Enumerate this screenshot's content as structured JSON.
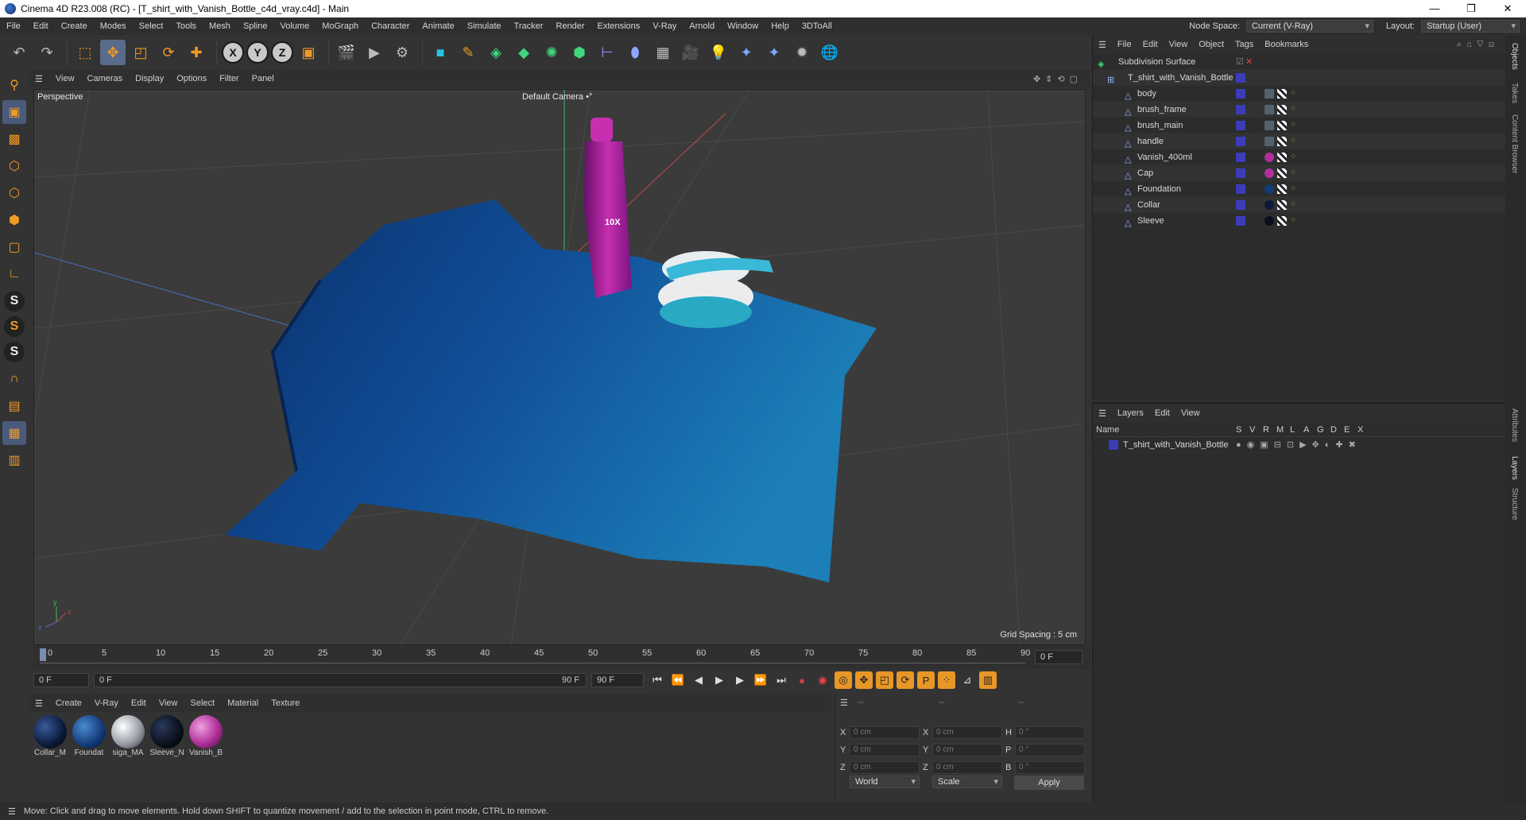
{
  "window": {
    "title": "Cinema 4D R23.008 (RC) - [T_shirt_with_Vanish_Bottle_c4d_vray.c4d] - Main",
    "minimize": "—",
    "maximize": "❐",
    "close": "✕"
  },
  "menubar": {
    "items": [
      "File",
      "Edit",
      "Create",
      "Modes",
      "Select",
      "Tools",
      "Mesh",
      "Spline",
      "Volume",
      "MoGraph",
      "Character",
      "Animate",
      "Simulate",
      "Tracker",
      "Render",
      "Extensions",
      "V-Ray",
      "Arnold",
      "Window",
      "Help",
      "3DToAll"
    ],
    "node_space_label": "Node Space:",
    "node_space_value": "Current (V-Ray)",
    "layout_label": "Layout:",
    "layout_value": "Startup (User)"
  },
  "viewport": {
    "menu": [
      "View",
      "Cameras",
      "Display",
      "Options",
      "Filter",
      "Panel"
    ],
    "label": "Perspective",
    "camera": "Default Camera",
    "camera_suffix": "•°",
    "grid_spacing": "Grid Spacing : 5 cm",
    "axis_x": "x",
    "axis_y": "y",
    "axis_z": "z"
  },
  "timeline": {
    "ticks": [
      "0",
      "5",
      "10",
      "15",
      "20",
      "25",
      "30",
      "35",
      "40",
      "45",
      "50",
      "55",
      "60",
      "65",
      "70",
      "75",
      "80",
      "85",
      "90"
    ],
    "current_frame": "0 F",
    "right_frame": "0 F",
    "start_field": "0 F",
    "range_start": "0 F",
    "range_end": "90 F",
    "end_field": "90 F"
  },
  "materials": {
    "menu": [
      "Create",
      "V-Ray",
      "Edit",
      "View",
      "Select",
      "Material",
      "Texture"
    ],
    "items": [
      {
        "name": "Collar_M",
        "color": "#0b1a3a"
      },
      {
        "name": "Foundat",
        "color": "#123b78"
      },
      {
        "name": "siga_MA",
        "color": "#9aa0a8"
      },
      {
        "name": "Sleeve_N",
        "color": "#0a0f1c"
      },
      {
        "name": "Vanish_B",
        "color": "#b0309a"
      }
    ]
  },
  "coords": {
    "headers": [
      "--",
      "--",
      "--"
    ],
    "rows": [
      {
        "a": "X",
        "av": "0 cm",
        "b": "X",
        "bv": "0 cm",
        "c": "H",
        "cv": "0 °"
      },
      {
        "a": "Y",
        "av": "0 cm",
        "b": "Y",
        "bv": "0 cm",
        "c": "P",
        "cv": "0 °"
      },
      {
        "a": "Z",
        "av": "0 cm",
        "b": "Z",
        "bv": "0 cm",
        "c": "B",
        "cv": "0 °"
      }
    ],
    "world": "World",
    "scale": "Scale",
    "apply": "Apply"
  },
  "objects": {
    "menu": [
      "File",
      "Edit",
      "View",
      "Object",
      "Tags",
      "Bookmarks"
    ],
    "root": "Subdivision Surface",
    "group": "T_shirt_with_Vanish_Bottle",
    "items": [
      {
        "name": "body",
        "mat": "#556070"
      },
      {
        "name": "brush_frame",
        "mat": "#556070"
      },
      {
        "name": "brush_main",
        "mat": "#556070"
      },
      {
        "name": "handle",
        "mat": "#556070"
      },
      {
        "name": "Vanish_400ml",
        "mat": "#b0309a"
      },
      {
        "name": "Cap",
        "mat": "#b0309a"
      },
      {
        "name": "Foundation",
        "mat": "#123b78"
      },
      {
        "name": "Collar",
        "mat": "#0b1a3a"
      },
      {
        "name": "Sleeve",
        "mat": "#0a0f1c"
      }
    ]
  },
  "layers": {
    "menu": [
      "Layers",
      "Edit",
      "View"
    ],
    "col_name": "Name",
    "cols": [
      "S",
      "V",
      "R",
      "M",
      "L",
      "A",
      "G",
      "D",
      "E",
      "X"
    ],
    "row": "T_shirt_with_Vanish_Bottle"
  },
  "side_tabs": [
    "Objects",
    "Takes",
    "Content Browser",
    "Attributes",
    "Layers",
    "Structure"
  ],
  "status": "Move: Click and drag to move elements. Hold down SHIFT to quantize movement / add to the selection in point mode, CTRL to remove.",
  "bottle_label": "10X"
}
